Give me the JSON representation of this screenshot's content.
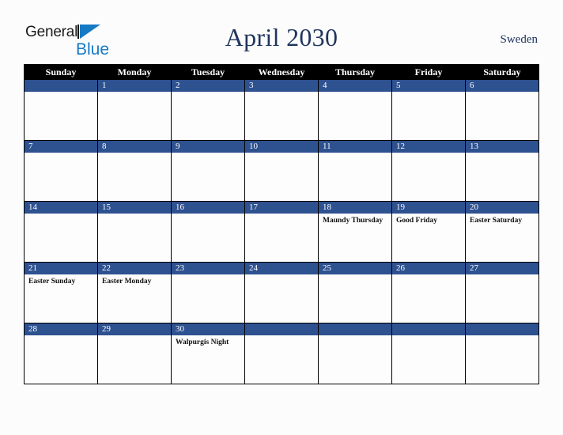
{
  "brand": {
    "name_part1": "General",
    "name_part2": "Blue",
    "mark": "triangle-logo-icon"
  },
  "header": {
    "title": "April 2030",
    "country": "Sweden"
  },
  "calendar": {
    "month": "April",
    "year": "2030",
    "weekday_headers": [
      "Sunday",
      "Monday",
      "Tuesday",
      "Wednesday",
      "Thursday",
      "Friday",
      "Saturday"
    ],
    "weeks": [
      [
        {
          "day": "",
          "events": []
        },
        {
          "day": "1",
          "events": []
        },
        {
          "day": "2",
          "events": []
        },
        {
          "day": "3",
          "events": []
        },
        {
          "day": "4",
          "events": []
        },
        {
          "day": "5",
          "events": []
        },
        {
          "day": "6",
          "events": []
        }
      ],
      [
        {
          "day": "7",
          "events": []
        },
        {
          "day": "8",
          "events": []
        },
        {
          "day": "9",
          "events": []
        },
        {
          "day": "10",
          "events": []
        },
        {
          "day": "11",
          "events": []
        },
        {
          "day": "12",
          "events": []
        },
        {
          "day": "13",
          "events": []
        }
      ],
      [
        {
          "day": "14",
          "events": []
        },
        {
          "day": "15",
          "events": []
        },
        {
          "day": "16",
          "events": []
        },
        {
          "day": "17",
          "events": []
        },
        {
          "day": "18",
          "events": [
            "Maundy Thursday"
          ]
        },
        {
          "day": "19",
          "events": [
            "Good Friday"
          ]
        },
        {
          "day": "20",
          "events": [
            "Easter Saturday"
          ]
        }
      ],
      [
        {
          "day": "21",
          "events": [
            "Easter Sunday"
          ]
        },
        {
          "day": "22",
          "events": [
            "Easter Monday"
          ]
        },
        {
          "day": "23",
          "events": []
        },
        {
          "day": "24",
          "events": []
        },
        {
          "day": "25",
          "events": []
        },
        {
          "day": "26",
          "events": []
        },
        {
          "day": "27",
          "events": []
        }
      ],
      [
        {
          "day": "28",
          "events": []
        },
        {
          "day": "29",
          "events": []
        },
        {
          "day": "30",
          "events": [
            "Walpurgis Night"
          ]
        },
        {
          "day": "",
          "events": []
        },
        {
          "day": "",
          "events": []
        },
        {
          "day": "",
          "events": []
        },
        {
          "day": "",
          "events": []
        }
      ]
    ]
  },
  "colors": {
    "page_background": "#fcfcfd",
    "header_bar": "#000000",
    "day_bar": "#2e5190",
    "title_text": "#20355e",
    "brand_blue": "#1679c4",
    "cell_background": "#fdfdfd",
    "grid_line": "#000000"
  }
}
